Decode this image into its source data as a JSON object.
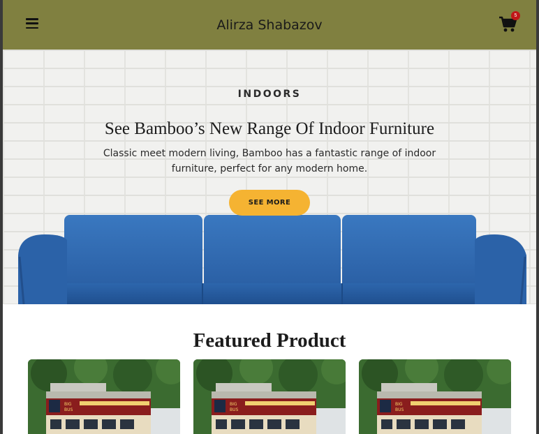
{
  "navbar": {
    "title": "Alirza Shabazov",
    "cart_count": "5"
  },
  "hero": {
    "kicker": "INDOORS",
    "title": "See Bamboo’s New Range Of Indoor Furniture",
    "text": "Classic meet modern living, Bamboo has a fantastic range of indoor furniture, perfect for any modern home.",
    "button_label": "SEE MORE"
  },
  "featured": {
    "title": "Featured Product",
    "products": [
      {
        "image": "double-decker-bus-photo"
      },
      {
        "image": "double-decker-bus-photo"
      },
      {
        "image": "double-decker-bus-photo"
      }
    ]
  },
  "colors": {
    "navbar": "#808040",
    "accent_button": "#f5b332",
    "sofa": "#2f6bb2",
    "badge": "#c01818"
  }
}
